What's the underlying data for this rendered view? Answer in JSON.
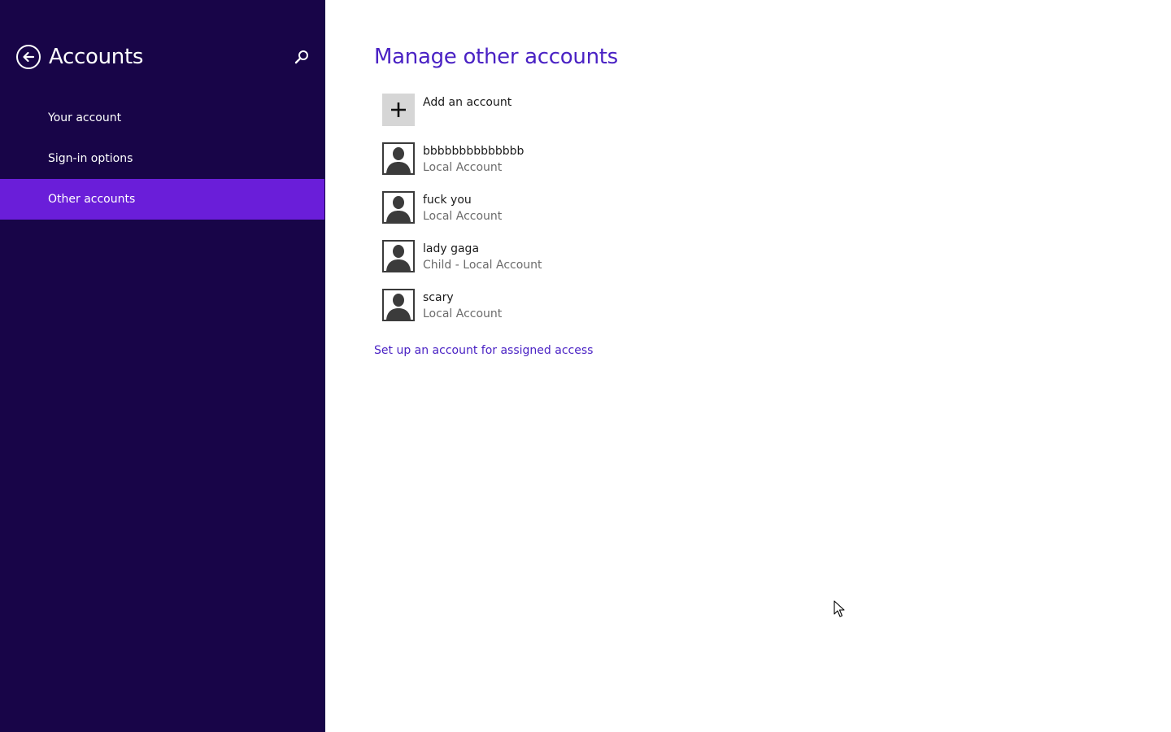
{
  "sidebar": {
    "title": "Accounts",
    "back_icon": "back-arrow-icon",
    "search_icon": "search-icon",
    "background": "#180548",
    "items": [
      {
        "label": "Your account",
        "selected": false
      },
      {
        "label": "Sign-in options",
        "selected": false
      },
      {
        "label": "Other accounts",
        "selected": true
      }
    ],
    "selected_color": "#6a1ed9"
  },
  "main": {
    "title": "Manage other accounts",
    "accent": "#4a22c4",
    "add_account": {
      "label": "Add an account",
      "icon": "plus-icon"
    },
    "accounts": [
      {
        "name": "bbbbbbbbbbbbbb",
        "type": "Local Account"
      },
      {
        "name": "fuck you",
        "type": "Local Account"
      },
      {
        "name": "lady gaga",
        "type": "Child - Local Account"
      },
      {
        "name": "scary",
        "type": "Local Account"
      }
    ],
    "assigned_access_link": "Set up an account for assigned access"
  }
}
